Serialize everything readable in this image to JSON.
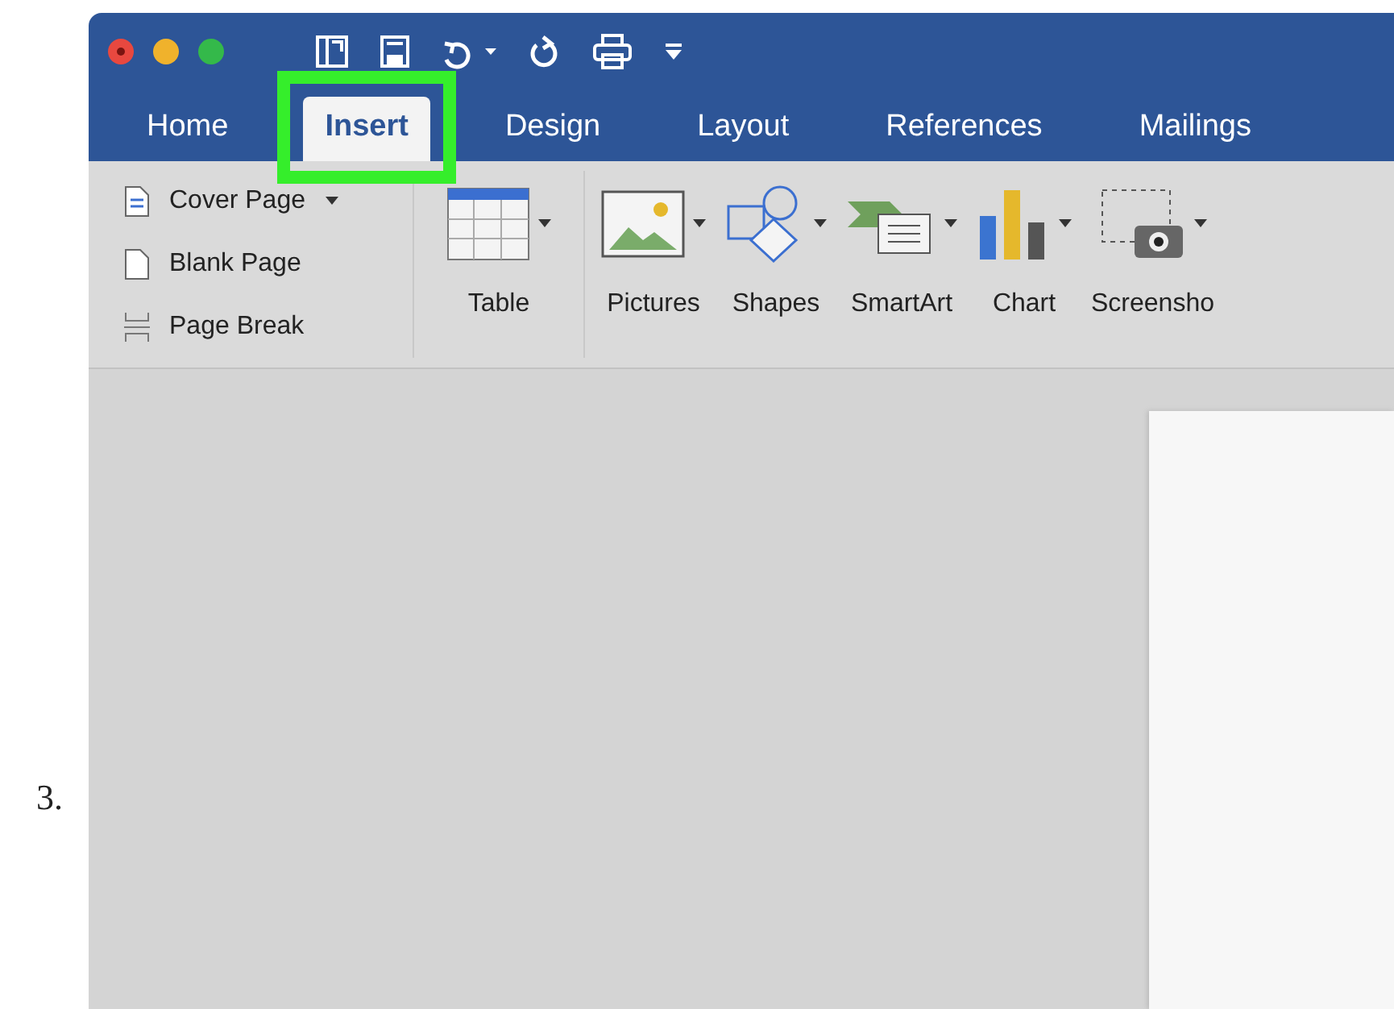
{
  "step_number": "3.",
  "tabs": [
    {
      "label": "Home",
      "selected": false,
      "highlighted": false
    },
    {
      "label": "Insert",
      "selected": true,
      "highlighted": true
    },
    {
      "label": "Design",
      "selected": false,
      "highlighted": false
    },
    {
      "label": "Layout",
      "selected": false,
      "highlighted": false
    },
    {
      "label": "References",
      "selected": false,
      "highlighted": false
    },
    {
      "label": "Mailings",
      "selected": false,
      "highlighted": false
    }
  ],
  "page_commands": [
    {
      "label": "Cover Page",
      "kind": "cover",
      "dropdown": true
    },
    {
      "label": "Blank Page",
      "kind": "blank",
      "dropdown": false
    },
    {
      "label": "Page Break",
      "kind": "break",
      "dropdown": false
    }
  ],
  "commands": [
    {
      "label": "Table",
      "kind": "table"
    },
    {
      "label": "Pictures",
      "kind": "pictures"
    },
    {
      "label": "Shapes",
      "kind": "shapes"
    },
    {
      "label": "SmartArt",
      "kind": "smartart"
    },
    {
      "label": "Chart",
      "kind": "chart"
    },
    {
      "label": "Screensho",
      "kind": "screenshot"
    }
  ]
}
